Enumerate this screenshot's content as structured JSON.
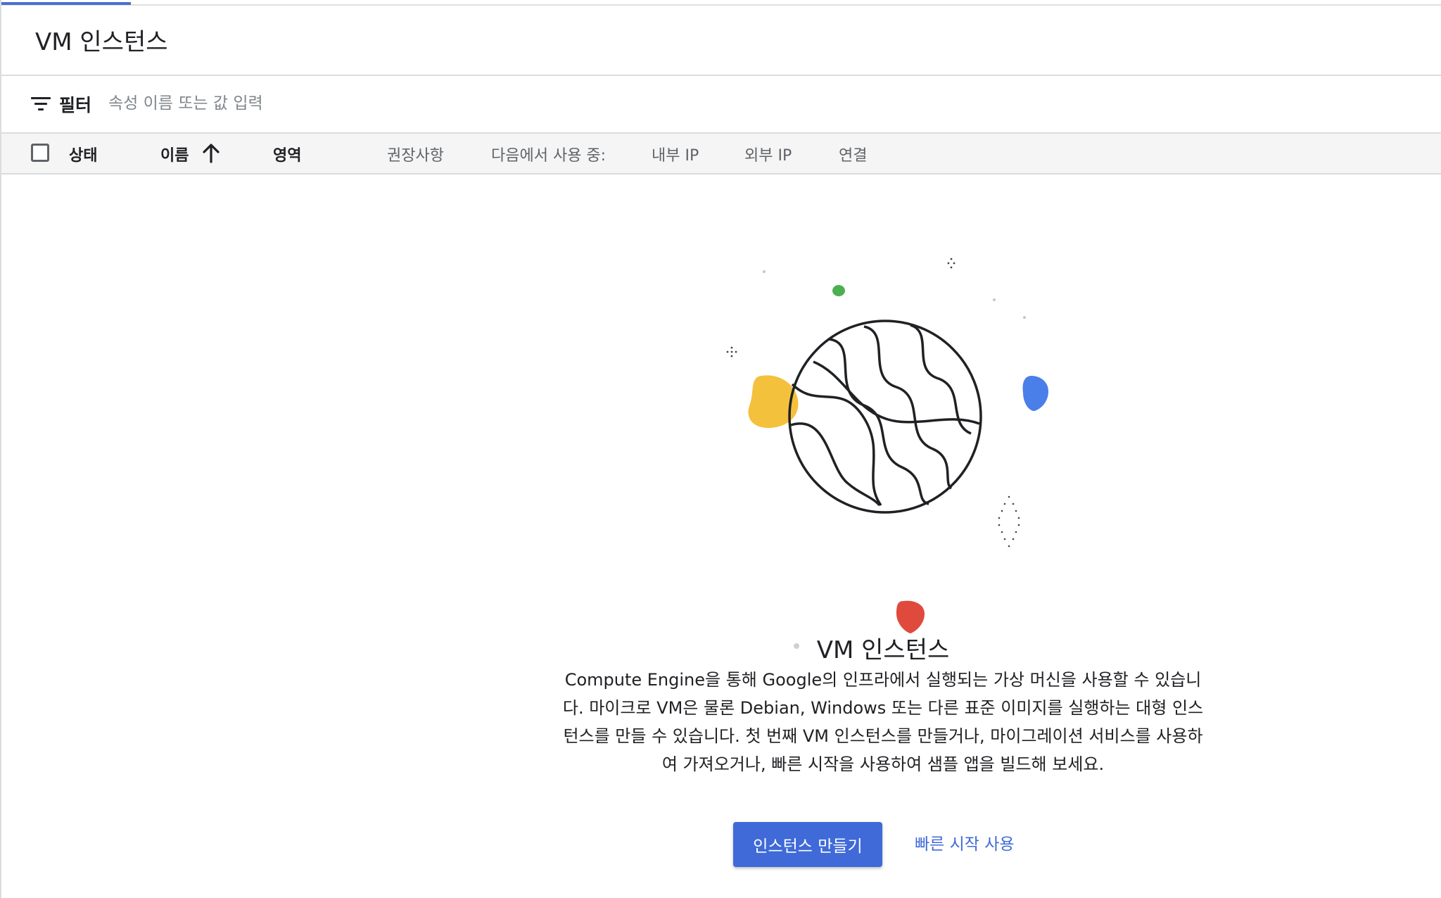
{
  "header": {
    "title": "VM 인스턴스"
  },
  "filter": {
    "label": "필터",
    "placeholder": "속성 이름 또는 값 입력"
  },
  "table": {
    "columns": [
      "상태",
      "이름",
      "영역",
      "권장사항",
      "다음에서 사용 중:",
      "내부 IP",
      "외부 IP",
      "연결"
    ],
    "sorted_column": "이름",
    "sort_direction": "ascending"
  },
  "empty_state": {
    "title": "VM 인스턴스",
    "description": "Compute Engine을 통해 Google의 인프라에서 실행되는 가상 머신을 사용할 수 있습니다. 마이크로 VM은 물론 Debian, Windows 또는 다른 표준 이미지를 실행하는 대형 인스턴스를 만들 수 있습니다. 첫 번째 VM 인스턴스를 만들거나, 마이그레이션 서비스를 사용하여 가져오거나, 빠른 시작을 사용하여 샘플 앱을 빌드해 보세요.",
    "primary_button": "인스턴스 만들기",
    "secondary_link": "빠른 시작 사용"
  },
  "icons": [
    "filter-icon",
    "arrow-up-icon",
    "globe-illustration"
  ],
  "colors": {
    "accent": "#3f6ad8",
    "dot_green": "#4caf50",
    "dot_blue": "#4a7ee8",
    "dot_yellow": "#f4c13c",
    "dot_red": "#e04a3c"
  }
}
